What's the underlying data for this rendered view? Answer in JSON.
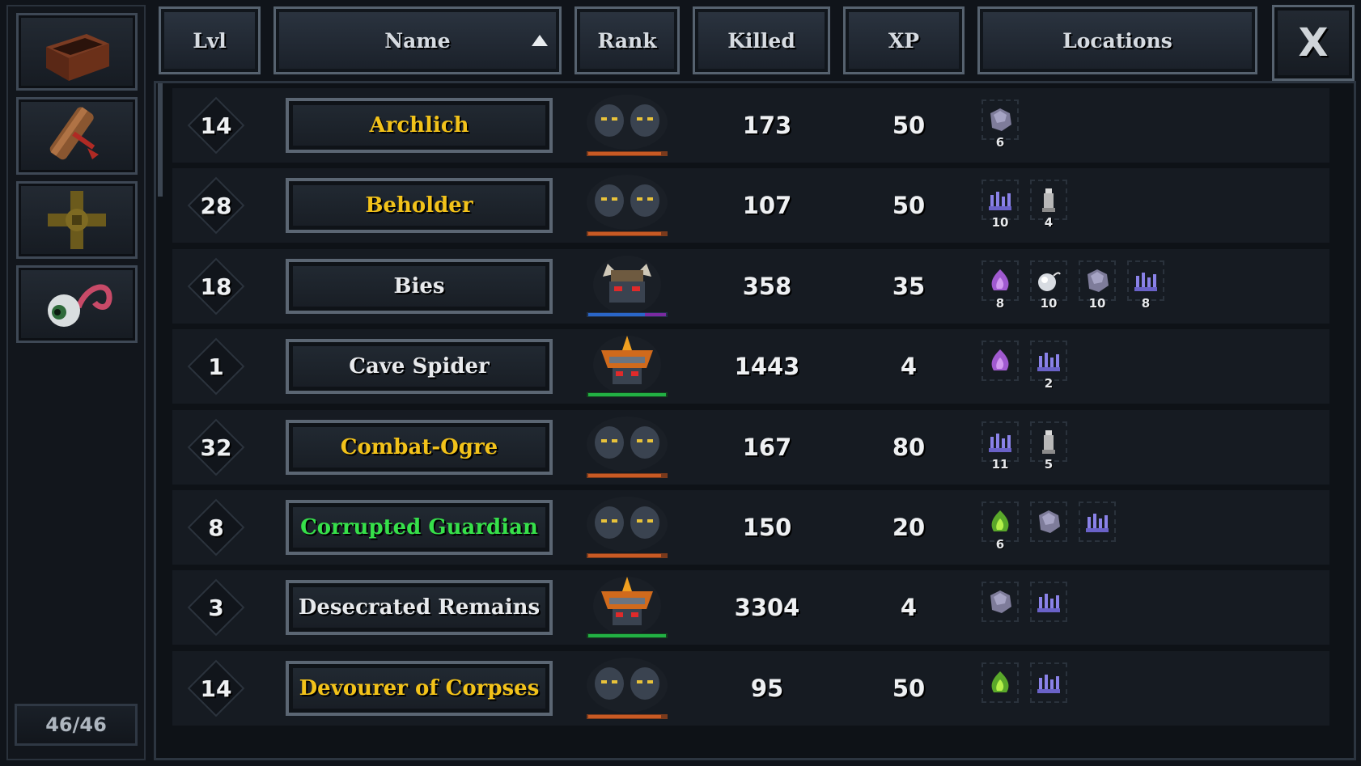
{
  "colors": {
    "elite": "#f2c21a",
    "uncommon": "#36e04a",
    "normal": "#e7e9ec"
  },
  "header": {
    "lvl": "Lvl",
    "name": "Name",
    "rank": "Rank",
    "killed": "Killed",
    "xp": "XP",
    "locations": "Locations",
    "close": "X"
  },
  "sidebar": {
    "buttons": [
      "chest-icon",
      "scroll-icon",
      "cross-icon",
      "eyeball-icon"
    ],
    "counter": "46/46"
  },
  "rows": [
    {
      "lvl": "14",
      "name": "Archlich",
      "tier": "elite",
      "rank": "twin",
      "killed": "173",
      "xp": "50",
      "locations": [
        {
          "icon": "rock-icon",
          "count": "6"
        }
      ]
    },
    {
      "lvl": "28",
      "name": "Beholder",
      "tier": "elite",
      "rank": "twin",
      "killed": "107",
      "xp": "50",
      "locations": [
        {
          "icon": "crystal-icon",
          "count": "10"
        },
        {
          "icon": "tower-icon",
          "count": "4"
        }
      ]
    },
    {
      "lvl": "18",
      "name": "Bies",
      "tier": "normal",
      "rank": "demon",
      "killed": "358",
      "xp": "35",
      "locations": [
        {
          "icon": "flame-icon",
          "count": "8"
        },
        {
          "icon": "bomb-icon",
          "count": "10"
        },
        {
          "icon": "rock-icon",
          "count": "10"
        },
        {
          "icon": "crystal-icon",
          "count": "8"
        }
      ]
    },
    {
      "lvl": "1",
      "name": "Cave Spider",
      "tier": "normal",
      "rank": "crown",
      "killed": "1443",
      "xp": "4",
      "locations": [
        {
          "icon": "flame-icon",
          "count": ""
        },
        {
          "icon": "crystal-icon",
          "count": "2"
        }
      ]
    },
    {
      "lvl": "32",
      "name": "Combat-Ogre",
      "tier": "elite",
      "rank": "twin",
      "killed": "167",
      "xp": "80",
      "locations": [
        {
          "icon": "crystal-icon",
          "count": "11"
        },
        {
          "icon": "tower-icon",
          "count": "5"
        }
      ]
    },
    {
      "lvl": "8",
      "name": "Corrupted Guardian",
      "tier": "uncommon",
      "rank": "twin",
      "killed": "150",
      "xp": "20",
      "locations": [
        {
          "icon": "green-flame-icon",
          "count": "6"
        },
        {
          "icon": "rock-icon",
          "count": ""
        },
        {
          "icon": "crystal-icon",
          "count": ""
        }
      ]
    },
    {
      "lvl": "3",
      "name": "Desecrated Remains",
      "tier": "normal",
      "rank": "crown",
      "killed": "3304",
      "xp": "4",
      "locations": [
        {
          "icon": "rock-icon",
          "count": ""
        },
        {
          "icon": "crystal-icon",
          "count": ""
        }
      ]
    },
    {
      "lvl": "14",
      "name": "Devourer of Corpses",
      "tier": "elite",
      "rank": "twin",
      "killed": "95",
      "xp": "50",
      "locations": [
        {
          "icon": "green-flame-icon",
          "count": ""
        },
        {
          "icon": "crystal-icon",
          "count": ""
        }
      ]
    }
  ]
}
